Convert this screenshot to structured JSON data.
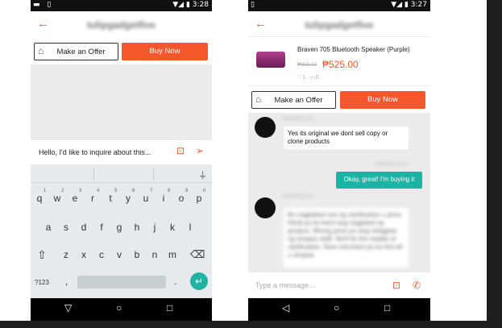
{
  "left_phone": {
    "status": {
      "time": "3:28"
    },
    "header": {
      "title": "tulipgadgetfive"
    },
    "make_offer_label": "Make an Offer",
    "buy_now_label": "Buy Now",
    "compose": {
      "text": "Hello, I'd like to inquire about this..."
    },
    "keyboard": {
      "row1": [
        "q",
        "w",
        "e",
        "r",
        "t",
        "y",
        "u",
        "i",
        "o",
        "p"
      ],
      "row1_numbers": [
        "1",
        "2",
        "3",
        "4",
        "5",
        "6",
        "7",
        "8",
        "9",
        "0"
      ],
      "row2": [
        "a",
        "s",
        "d",
        "f",
        "g",
        "h",
        "j",
        "k",
        "l"
      ],
      "row3": [
        "z",
        "x",
        "c",
        "v",
        "b",
        "n",
        "m"
      ],
      "symbols_label": "?123",
      "comma": ",",
      "period": "."
    }
  },
  "right_phone": {
    "status": {
      "time": "3:27"
    },
    "header": {
      "title": "tulipgadgetfive"
    },
    "product": {
      "name": "Braven 705 Bluetooth Speaker (Purple)",
      "old_price": "₱995.00",
      "price": "₱525.00",
      "likes": "1",
      "comments": "0"
    },
    "make_offer_label": "Make an Offer",
    "buy_now_label": "Buy Now",
    "messages": [
      {
        "time": "10/16/2015 10:16",
        "text": "Yes its original we dont sell copy or clone products"
      },
      {
        "time": "10/16/2015 10:16",
        "text": "Okay, great! I'm buying it"
      },
      {
        "time": "10/16/2015 10:19",
        "text": "Bo nagbabon ara ng clarification c price. Hindi po ko kami ang nagpbad ng product. Wrong price po ang mitagpas ng shopee staff. We'll fix the middle of clarification. New merchant po ko kini all u shopee"
      }
    ],
    "compose_placeholder": "Type a message..."
  }
}
